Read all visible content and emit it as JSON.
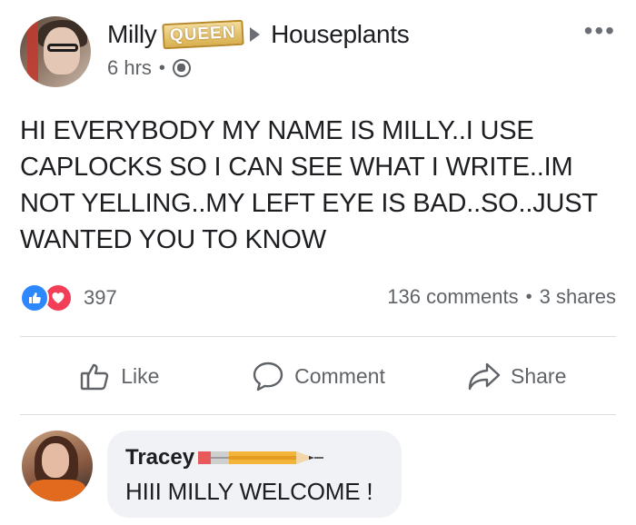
{
  "post": {
    "author": "Milly",
    "badge": "QUEEN",
    "group": "Houseplants",
    "time": "6 hrs",
    "time_separator": "•",
    "more_label": "•••",
    "body": "HI EVERYBODY MY NAME IS MILLY..I USE CAPLOCKS SO I CAN SEE WHAT I WRITE..IM NOT YELLING..MY LEFT EYE IS BAD..SO..JUST WANTED YOU TO KNOW"
  },
  "reactions": {
    "count": "397",
    "icons": [
      "like-reaction-icon",
      "love-reaction-icon"
    ],
    "like_color": "#2d88ff",
    "love_color": "#f33e58"
  },
  "stats": {
    "comments": "136 comments",
    "separator": "•",
    "shares": "3 shares"
  },
  "actions": {
    "like": "Like",
    "comment": "Comment",
    "share": "Share"
  },
  "comment": {
    "author": "Tracey",
    "text": "HIII MILLY WELCOME !"
  }
}
